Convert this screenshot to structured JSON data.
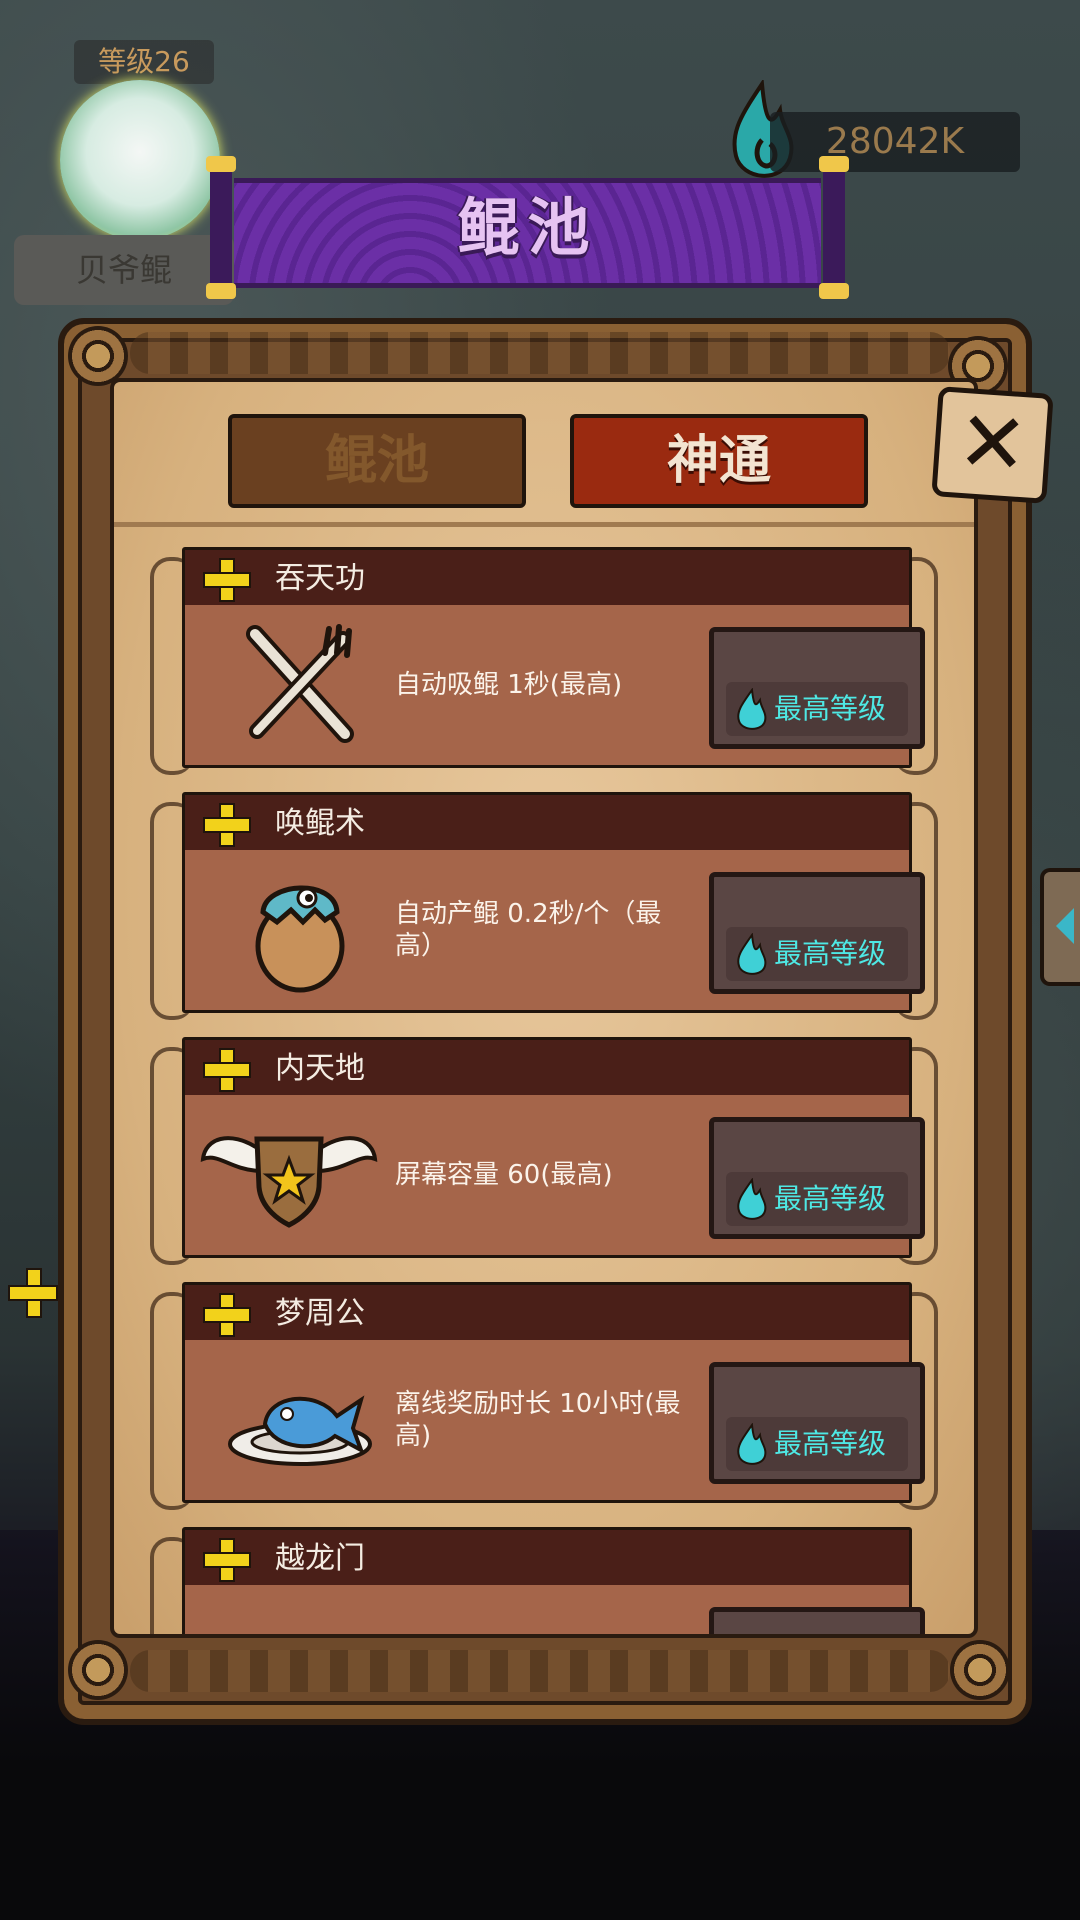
{
  "player": {
    "level_label": "等级26",
    "name": "贝爷鲲"
  },
  "currency": {
    "value": "28042K",
    "icon": "blue-flame-icon"
  },
  "title": "鲲池",
  "tabs": [
    {
      "label": "鲲池",
      "active": false
    },
    {
      "label": "神通",
      "active": true
    }
  ],
  "close_icon": "close-x-icon",
  "skills": [
    {
      "name": "吞天功",
      "desc": "自动吸鲲 1秒(最高)",
      "button": "最高等级",
      "icon": "fork-knife-icon"
    },
    {
      "name": "唤鲲术",
      "desc": "自动产鲲 0.2秒/个（最高）",
      "button": "最高等级",
      "icon": "egg-hatching-icon"
    },
    {
      "name": "内天地",
      "desc": "屏幕容量 60(最高)",
      "button": "最高等级",
      "icon": "winged-shield-icon"
    },
    {
      "name": "梦周公",
      "desc": "离线奖励时长 10小时(最高)",
      "button": "最高等级",
      "icon": "fish-on-plate-icon"
    },
    {
      "name": "越龙门",
      "desc": "",
      "button": "",
      "icon": ""
    }
  ],
  "colors": {
    "banner": "#6a2ea4",
    "active_tab": "#9a2a10",
    "button_text": "#4ee8e4"
  }
}
